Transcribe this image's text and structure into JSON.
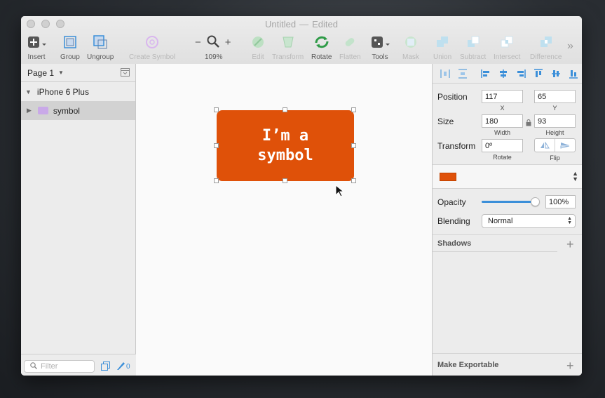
{
  "window": {
    "title": "Untitled",
    "separator": "—",
    "status": "Edited"
  },
  "toolbar": {
    "insert": "Insert",
    "group": "Group",
    "ungroup": "Ungroup",
    "create_symbol": "Create Symbol",
    "zoom_minus": "−",
    "zoom_plus": "+",
    "zoom_level": "109%",
    "edit": "Edit",
    "transform": "Transform",
    "rotate": "Rotate",
    "flatten": "Flatten",
    "tools": "Tools",
    "mask": "Mask",
    "union": "Union",
    "subtract": "Subtract",
    "intersect": "Intersect",
    "difference": "Difference",
    "overflow": "»"
  },
  "layers": {
    "page_selector": "Page 1",
    "artboard": "iPhone 6 Plus",
    "symbol_layer": "symbol",
    "filter_placeholder": "Filter",
    "slice_count": "0"
  },
  "canvas": {
    "symbol_text": "I’m a\nsymbol",
    "symbol_color": "#df5109"
  },
  "inspector": {
    "position_label": "Position",
    "x_value": "117",
    "y_value": "65",
    "x_label": "X",
    "y_label": "Y",
    "size_label": "Size",
    "width_value": "180",
    "height_value": "93",
    "width_label": "Width",
    "height_label": "Height",
    "transform_label": "Transform",
    "rotate_value": "0º",
    "rotate_label": "Rotate",
    "flip_label": "Flip",
    "opacity_label": "Opacity",
    "opacity_value": "100%",
    "opacity_level": 1.0,
    "blending_label": "Blending",
    "blending_value": "Normal",
    "shadows_label": "Shadows",
    "export_label": "Make Exportable"
  },
  "colors": {
    "accent": "#3b8fd9",
    "symbol_purple": "#c9a9e8",
    "selection": "#d2d2d2"
  }
}
